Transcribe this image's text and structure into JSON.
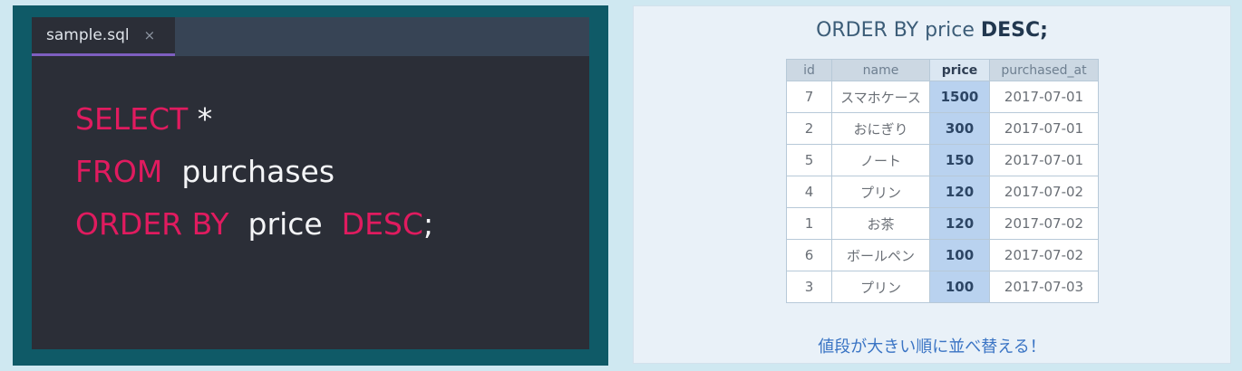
{
  "editor": {
    "tab_name": "sample.sql",
    "tab_close": "×",
    "code": {
      "line1": {
        "keyword": "SELECT",
        "rest": " *"
      },
      "line2": {
        "keyword": "FROM",
        "rest": "  purchases"
      },
      "line3": {
        "keyword": "ORDER BY",
        "middle": "  price  ",
        "keyword2": "DESC",
        "rest": ";"
      }
    }
  },
  "result": {
    "title_plain": "ORDER BY price ",
    "title_bold": "DESC;",
    "columns": [
      "id",
      "name",
      "price",
      "purchased_at"
    ],
    "rows": [
      [
        "7",
        "スマホケース",
        "1500",
        "2017-07-01"
      ],
      [
        "2",
        "おにぎり",
        "300",
        "2017-07-01"
      ],
      [
        "5",
        "ノート",
        "150",
        "2017-07-01"
      ],
      [
        "4",
        "プリン",
        "120",
        "2017-07-02"
      ],
      [
        "1",
        "お茶",
        "120",
        "2017-07-02"
      ],
      [
        "6",
        "ボールペン",
        "100",
        "2017-07-02"
      ],
      [
        "3",
        "プリン",
        "100",
        "2017-07-03"
      ]
    ],
    "footer": "値段が大きい順に並べ替える！"
  },
  "colors": {
    "keyword": "#e01b5f",
    "highlight": "#b9d2ef",
    "footer_text": "#3a74c4"
  }
}
